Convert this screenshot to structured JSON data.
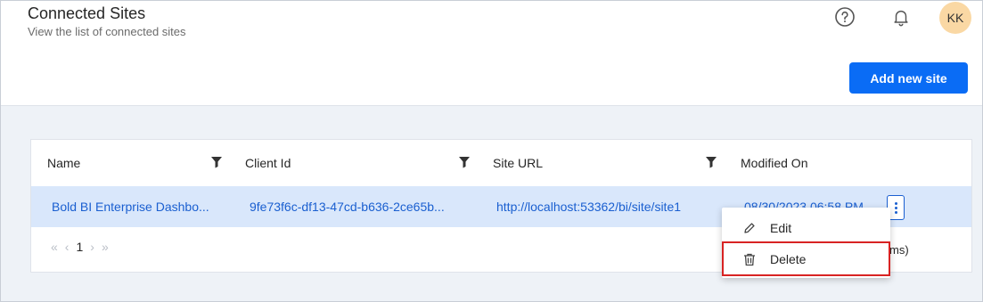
{
  "header": {
    "title": "Connected Sites",
    "subtitle": "View the list of connected sites",
    "avatar_initials": "KK",
    "add_button_label": "Add new site"
  },
  "table": {
    "columns": [
      "Name",
      "Client Id",
      "Site URL",
      "Modified On"
    ],
    "rows": [
      {
        "name": "Bold BI Enterprise Dashbo...",
        "client_id": "9fe73f6c-df13-47cd-b636-2ce65b...",
        "site_url": "http://localhost:53362/bi/site/site1",
        "modified_on": "08/30/2023 06:58 PM"
      }
    ],
    "pager": {
      "current_page": "1",
      "items_text_tail": "ms)"
    }
  },
  "context_menu": {
    "items": [
      {
        "label": "Edit",
        "icon": "pencil-icon"
      },
      {
        "label": "Delete",
        "icon": "trash-icon"
      }
    ]
  },
  "colors": {
    "accent": "#0a6cf5",
    "selected_row": "#d9e7fb",
    "avatar_bg": "#fad8a4",
    "highlight_border": "#d82323"
  }
}
